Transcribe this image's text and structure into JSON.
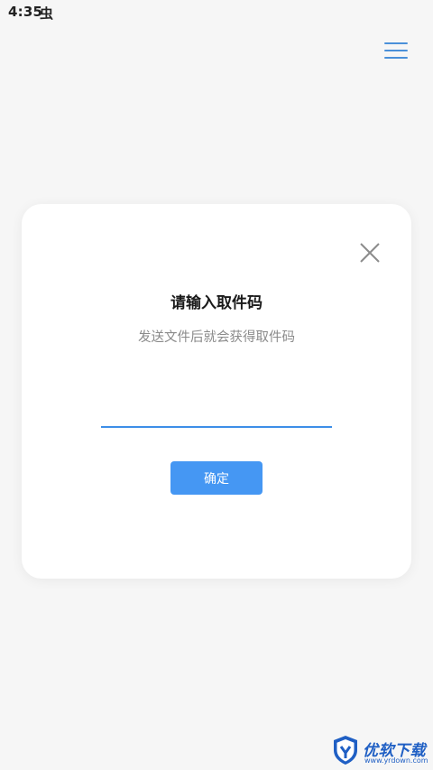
{
  "status_bar": {
    "time": "4:35",
    "notification_icon": "虫"
  },
  "header": {
    "menu_icon": "hamburger-menu-icon"
  },
  "dialog": {
    "close_icon": "close-icon",
    "title": "请输入取件码",
    "subtitle": "发送文件后就会获得取件码",
    "input_value": "",
    "confirm_label": "确定"
  },
  "watermark": {
    "name": "优软下载",
    "url": "www.yrdown.com"
  },
  "colors": {
    "accent": "#4597f3",
    "input_underline": "#3d8ee8",
    "menu_icon": "#4a90d9",
    "background": "#f6f6f6",
    "dialog_background": "#ffffff",
    "watermark": "#1f5fc4"
  }
}
